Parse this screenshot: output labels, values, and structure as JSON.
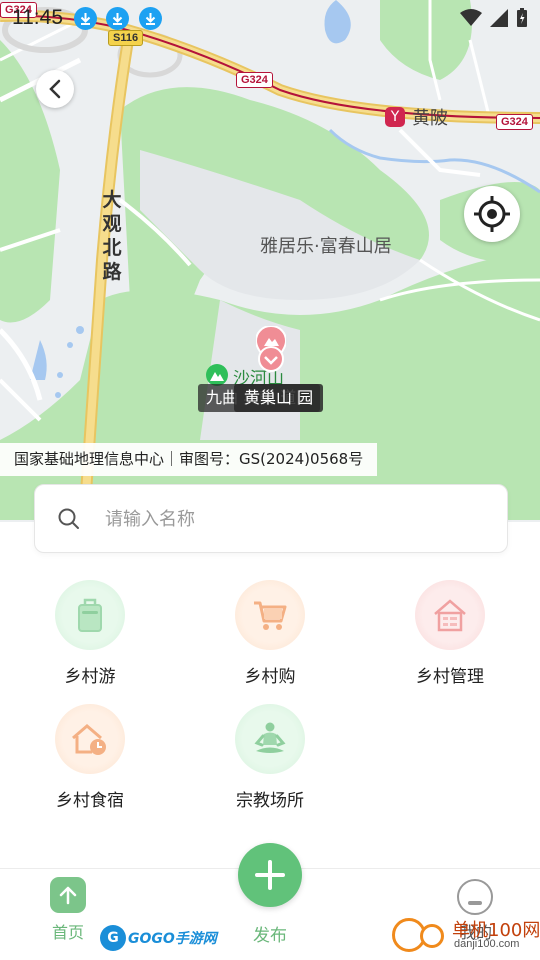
{
  "status_bar": {
    "time": "11:45"
  },
  "map": {
    "road_label": "大观北路",
    "place_label": "雅居乐·富春山居",
    "metro_station": "黄陂",
    "metro_icon_glyph": "Y",
    "shields": {
      "s116": "S116",
      "g324_a": "G324",
      "g324_b": "G324",
      "g324_c": "G324"
    },
    "poi_label": "沙河山",
    "marker_back_tag": "九曲 奥朝 道园",
    "marker_tag": "黄巢山 园",
    "copyright": "国家基础地理信息中心｜审图号：GS(2024)0568号"
  },
  "search": {
    "placeholder": "请输入名称"
  },
  "features": [
    {
      "label": "乡村游",
      "icon": "luggage-icon"
    },
    {
      "label": "乡村购",
      "icon": "shopping-cart-icon"
    },
    {
      "label": "乡村管理",
      "icon": "house-list-icon"
    },
    {
      "label": "乡村食宿",
      "icon": "house-clock-icon"
    },
    {
      "label": "宗教场所",
      "icon": "meditation-icon"
    }
  ],
  "bottom_nav": {
    "home": "首页",
    "publish": "发布",
    "mine": "我的"
  },
  "watermarks": {
    "gogo": "GOGO手游网",
    "gogo_ball": "G",
    "danji": "单机100网",
    "danji_url": "danji100.com"
  },
  "colors": {
    "accent_green": "#61c27a",
    "park_green": "#b4e3ae",
    "highway_yellow": "#f6dd8d",
    "national_road_red": "#b4133a",
    "water_blue": "#a6c8f0"
  }
}
